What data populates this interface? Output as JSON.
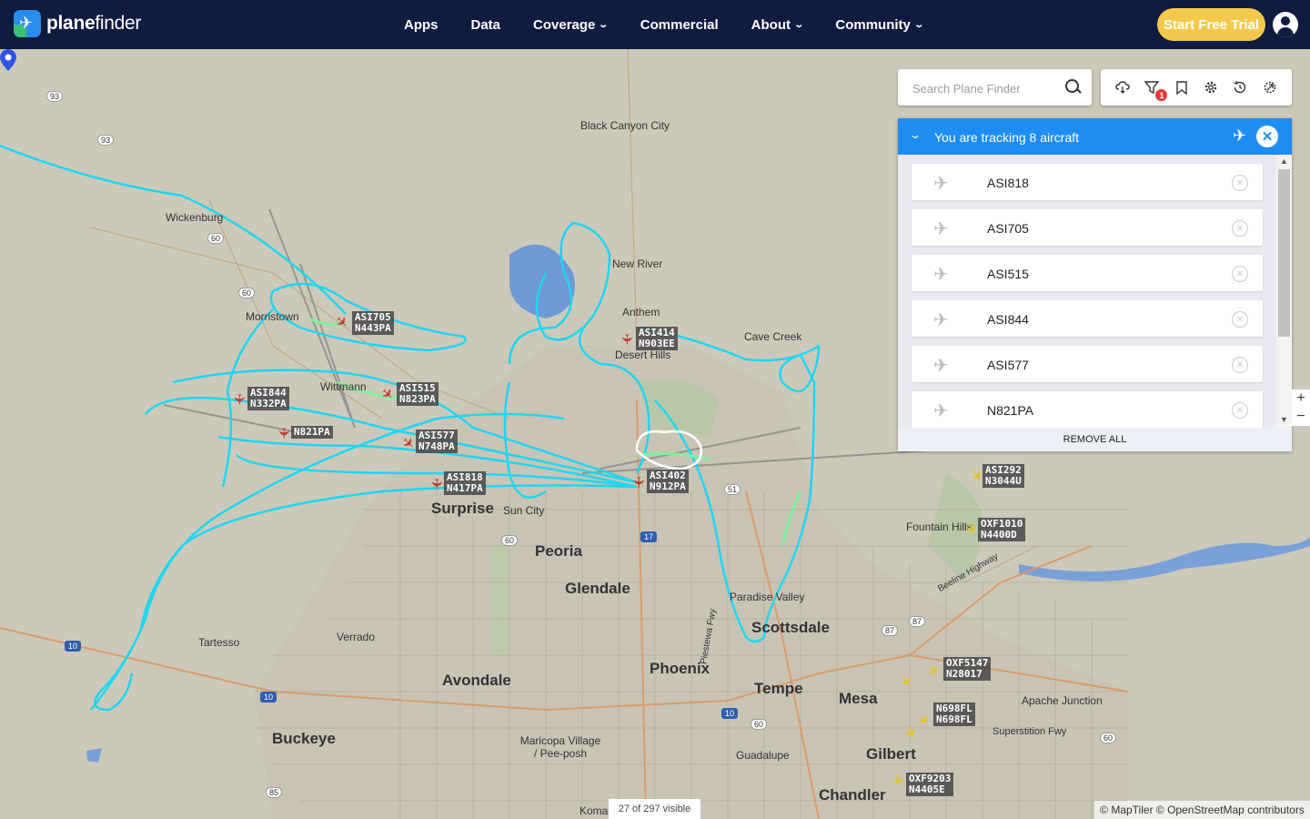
{
  "nav": {
    "logo_plane": "✈",
    "logo_bold": "plane",
    "logo_rest": "finder",
    "items": [
      {
        "label": "Apps",
        "dropdown": false
      },
      {
        "label": "Data",
        "dropdown": false
      },
      {
        "label": "Coverage",
        "dropdown": true
      },
      {
        "label": "Commercial",
        "dropdown": false
      },
      {
        "label": "About",
        "dropdown": true
      },
      {
        "label": "Community",
        "dropdown": true
      }
    ],
    "cta": "Start Free Trial",
    "chevron": "⌄"
  },
  "search": {
    "placeholder": "Search Plane Finder"
  },
  "toolbar": {
    "icons": [
      "cloud-icon",
      "filter-icon",
      "bookmark-icon",
      "settings-icon",
      "history-icon",
      "airport-icon"
    ],
    "filter_badge": "1"
  },
  "tracking": {
    "title": "You are tracking 8 aircraft",
    "chevron": "⌄",
    "close": "✕",
    "plane_glyph": "✈",
    "remove_glyph": "✕",
    "items": [
      "ASI818",
      "ASI705",
      "ASI515",
      "ASI844",
      "ASI577",
      "N821PA"
    ],
    "remove_all": "REMOVE ALL",
    "scroll_up": "▲",
    "scroll_down": "▼"
  },
  "zoom": {
    "in": "+",
    "out": "−"
  },
  "status": {
    "visible": "27 of 297 visible",
    "attribution": "© MapTiler © OpenStreetMap contributors"
  },
  "map": {
    "places": [
      {
        "name": "Black Canyon City",
        "big": false
      },
      {
        "name": "Wickenburg",
        "big": false
      },
      {
        "name": "New River",
        "big": false
      },
      {
        "name": "Anthem",
        "big": false
      },
      {
        "name": "Cave Creek",
        "big": false
      },
      {
        "name": "Morristown",
        "big": false
      },
      {
        "name": "Wittmann",
        "big": false
      },
      {
        "name": "Desert Hills",
        "big": false
      },
      {
        "name": "Surprise",
        "big": true
      },
      {
        "name": "Sun City",
        "big": false
      },
      {
        "name": "Peoria",
        "big": true
      },
      {
        "name": "Glendale",
        "big": true
      },
      {
        "name": "Fountain Hills",
        "big": false
      },
      {
        "name": "Paradise Valley",
        "big": false
      },
      {
        "name": "Scottsdale",
        "big": true
      },
      {
        "name": "Tartesso",
        "big": false
      },
      {
        "name": "Verrado",
        "big": false
      },
      {
        "name": "Avondale",
        "big": true
      },
      {
        "name": "Phoenix",
        "big": true
      },
      {
        "name": "Tempe",
        "big": true
      },
      {
        "name": "Mesa",
        "big": true
      },
      {
        "name": "Apache Junction",
        "big": false
      },
      {
        "name": "Buckeye",
        "big": true
      },
      {
        "name": "Maricopa Village / Pee-posh",
        "big": false
      },
      {
        "name": "Guadalupe",
        "big": false
      },
      {
        "name": "Gilbert",
        "big": true
      },
      {
        "name": "Chandler",
        "big": true
      },
      {
        "name": "Superstition Fwy",
        "big": false
      },
      {
        "name": "Beeline Highway",
        "big": false
      },
      {
        "name": "Piestewa Fwy",
        "big": false
      },
      {
        "name": "Komat",
        "big": false
      }
    ],
    "shields": [
      "93",
      "93",
      "60",
      "60",
      "60",
      "60",
      "17",
      "51",
      "87",
      "87",
      "60",
      "10",
      "10",
      "10",
      "85"
    ],
    "aircraft": [
      {
        "line1": "ASI705",
        "line2": "N443PA",
        "color": "red"
      },
      {
        "line1": "ASI414",
        "line2": "N903EE",
        "color": "red"
      },
      {
        "line1": "ASI515",
        "line2": "N823PA",
        "color": "red"
      },
      {
        "line1": "ASI844",
        "line2": "N332PA",
        "color": "red"
      },
      {
        "line1": "N821PA",
        "line2": "",
        "color": "red"
      },
      {
        "line1": "ASI577",
        "line2": "N748PA",
        "color": "red"
      },
      {
        "line1": "ASI818",
        "line2": "N417PA",
        "color": "red"
      },
      {
        "line1": "ASI402",
        "line2": "N912PA",
        "color": "red"
      },
      {
        "line1": "ASI292",
        "line2": "N3044U",
        "color": "yellow"
      },
      {
        "line1": "OXF1010",
        "line2": "N4400D",
        "color": "yellow"
      },
      {
        "line1": "OXF5147",
        "line2": "N28017",
        "color": "yellow"
      },
      {
        "line1": "N698FL",
        "line2": "N698FL",
        "color": "yellow"
      },
      {
        "line1": "OXF9203",
        "line2": "N4405E",
        "color": "yellow"
      }
    ],
    "plane_glyph": "✈"
  }
}
